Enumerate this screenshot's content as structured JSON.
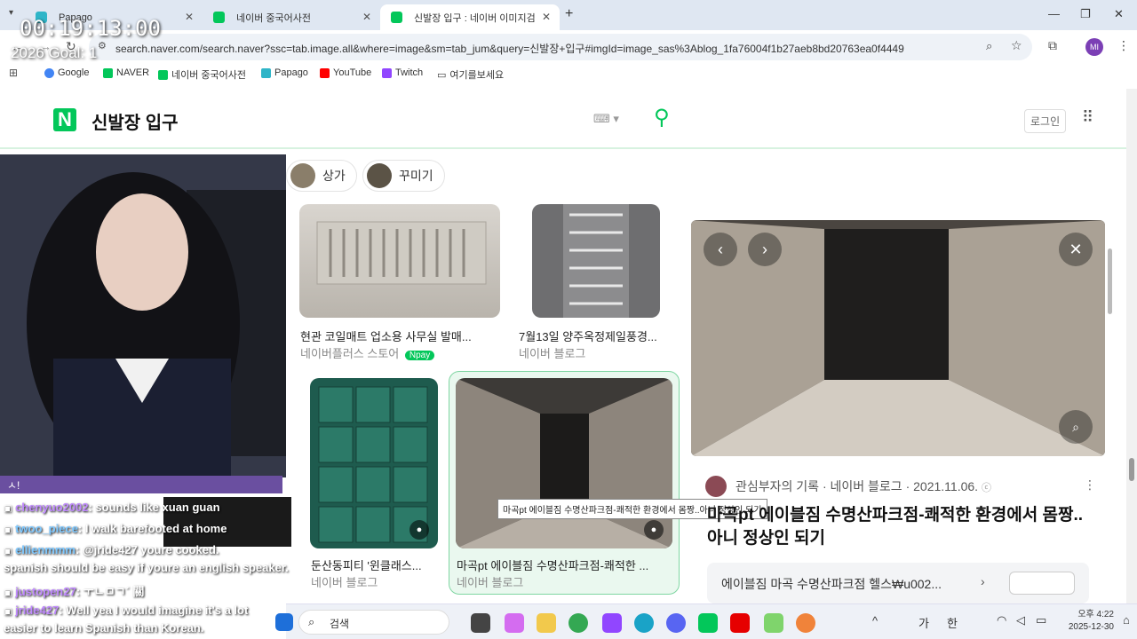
{
  "overlay": {
    "timer": "00:19:13:00",
    "goal": "2026 Goal: 1"
  },
  "tabs": [
    {
      "label": "Papago"
    },
    {
      "label": "네이버 중국어사전"
    },
    {
      "label": "신발장 입구 : 네이버 이미지검"
    }
  ],
  "address": {
    "url": "search.naver.com/search.naver?ssc=tab.image.all&where=image&sm=tab_jum&query=신발장+입구#imgId=image_sas%3Ablog_1fa76004f1b27aeb8bd20763ea0f4449"
  },
  "profile": {
    "initials": "MI"
  },
  "bookmarks": [
    "Google",
    "NAVER",
    "네이버 중국어사전",
    "Papago",
    "YouTube",
    "Twitch",
    "여기를보세요"
  ],
  "colors": {
    "naver_green": "#03c75a",
    "twitch_purple": "#9146ff"
  },
  "header": {
    "logo": "N",
    "query": "신발장 입구",
    "login": "로그인"
  },
  "chips": [
    {
      "label": "상가"
    },
    {
      "label": "꾸미기"
    }
  ],
  "results": [
    {
      "title": "현관 코일매트 업소용 사무실 발매...",
      "source": "네이버플러스 스토어",
      "badge": "Npay"
    },
    {
      "title": "7월13일 양주옥정제일풍경...",
      "source": "네이버 블로그"
    },
    {
      "title": "둔산동피티 '윈클래스...",
      "source": "네이버 블로그"
    },
    {
      "title": "마곡pt 에이블짐 수명산파크점-쾌적한 ...",
      "source": "네이버 블로그"
    }
  ],
  "tooltip": "마곡pt 에이블짐 수명산파크점-쾌적한 환경에서 몸짱..아니 정상인 되기",
  "detail": {
    "author": "관심부자의 기록",
    "source": "네이버 블로그",
    "date": "2021.11.06.",
    "title": "마곡pt 에이블짐 수명산파크점-쾌적한 환경에서 몸짱..아니 정상인 되기",
    "related": "에이블짐 마곡 수명산파크점 헬스₩u002..."
  },
  "chat": {
    "banner": "ㅅ!",
    "messages": [
      {
        "user": "chenyuo2002",
        "text": ": sounds like xuan guan",
        "color": "#c08aff"
      },
      {
        "user": "twoo_piece",
        "text": ": I walk barefooted at home",
        "color": "#7ec8ff"
      },
      {
        "user": "ellienmmm",
        "text": ": @jride427 youre cooked.",
        "color": "#7ec8ff"
      },
      {
        "user": "",
        "text": "spanish should be easy if youre an english speaker.",
        "color": "#ffffff"
      },
      {
        "user": "justopen27",
        "text": ": ㅜㄴㅁㄱ´ 關",
        "color": "#c08aff"
      },
      {
        "user": "jride427",
        "text": ": Well yea I would imagine it's a lot",
        "color": "#c08aff"
      },
      {
        "user": "",
        "text": "easier to learn Spanish than Korean.",
        "color": "#ffffff"
      }
    ]
  },
  "taskbar": {
    "search": "검색",
    "ime1": "가",
    "ime2": "한",
    "clock_time": "오후 4:22",
    "clock_date": "2025-12-30"
  }
}
